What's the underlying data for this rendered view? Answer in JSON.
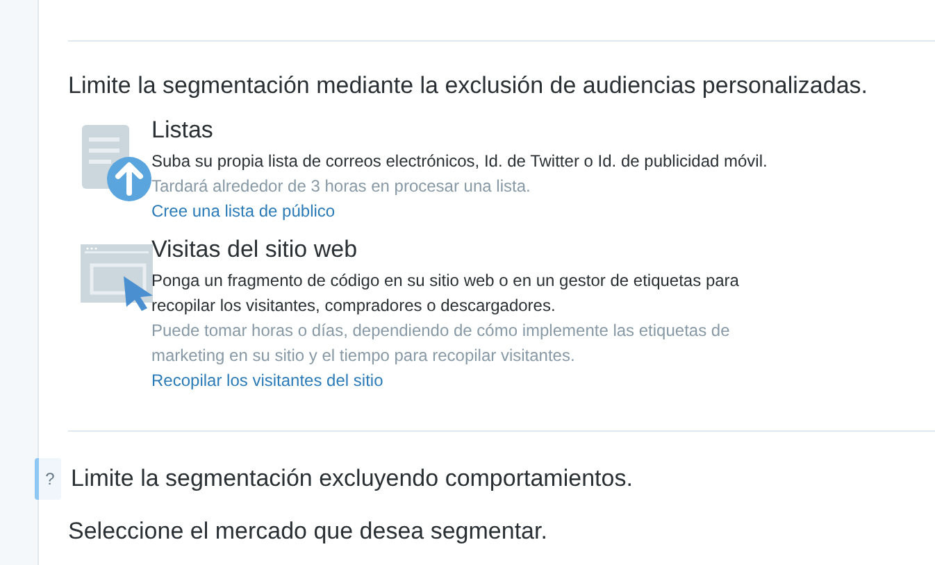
{
  "exclusion_heading": "Limite la segmentación mediante la exclusión de audiencias personalizadas.",
  "options": [
    {
      "kind": "list",
      "title": "Listas",
      "description": "Suba su propia lista de correos electrónicos, Id. de Twitter o Id. de publicidad móvil.",
      "note": "Tardará alrededor de 3 horas en procesar una lista.",
      "link": "Cree una lista de público"
    },
    {
      "kind": "website",
      "title": "Visitas del sitio web",
      "description": "Ponga un fragmento de código en su sitio web o en un gestor de etiquetas para recopilar los visitantes, compradores o descargadores.",
      "note": "Puede tomar horas o días, dependiendo de cómo implemente las etiquetas de marketing en su sitio y el tiempo para recopilar visitantes.",
      "link": "Recopilar los visitantes del sitio"
    }
  ],
  "behavior_section": {
    "help": "?",
    "heading": "Limite la segmentación excluyendo comportamientos.",
    "prompt": "Seleccione el mercado que desea segmentar."
  }
}
